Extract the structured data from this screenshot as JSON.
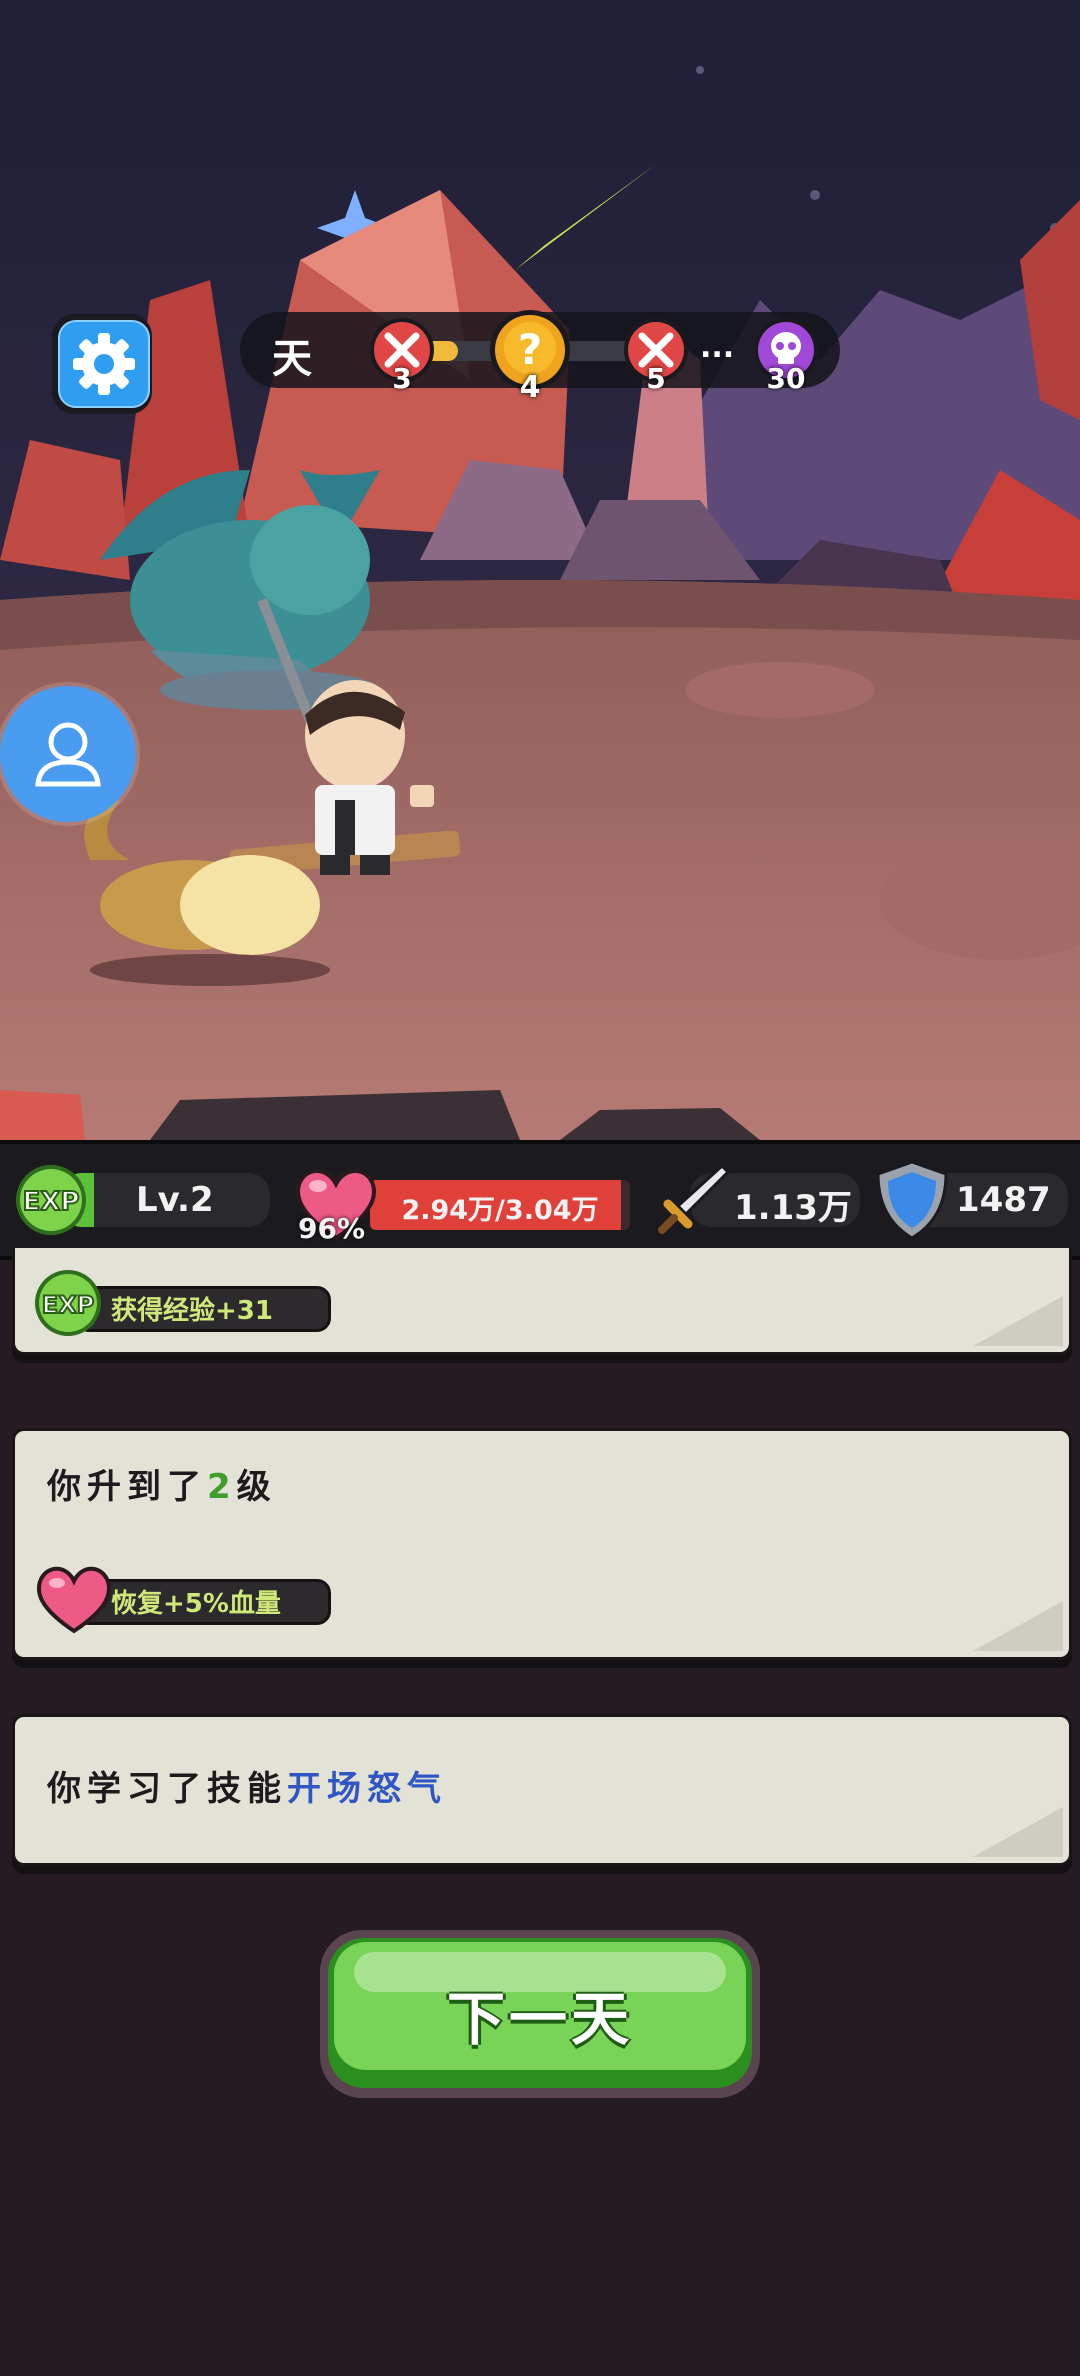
{
  "hud": {
    "day_label": "天",
    "stages": [
      {
        "type": "battle",
        "number": "3"
      },
      {
        "type": "mystery",
        "number": "4"
      },
      {
        "type": "battle",
        "number": "5"
      },
      {
        "type": "ellipsis",
        "text": "..."
      },
      {
        "type": "boss",
        "number": "30"
      }
    ],
    "stage_progress": 0.3
  },
  "stats": {
    "level": "Lv.2",
    "hp_percent_label": "96%",
    "hp_text": "2.94万/3.04万",
    "hp_fraction": 0.967,
    "attack": "1.13万",
    "defense": "1487"
  },
  "log": {
    "exp_reward": "获得经验+31",
    "level_up_prefix": "你升到了",
    "level_up_value": "2",
    "level_up_suffix": "级",
    "heal_reward": "恢复+5%血量",
    "skill_prefix": "你学习了技能",
    "skill_name": "开场怒气"
  },
  "button": {
    "next_day": "下一天"
  },
  "colors": {
    "accent_green": "#5cc13a",
    "hp_red": "#e0403a",
    "level_green": "#3f9d2c",
    "skill_blue": "#2f56c4"
  }
}
